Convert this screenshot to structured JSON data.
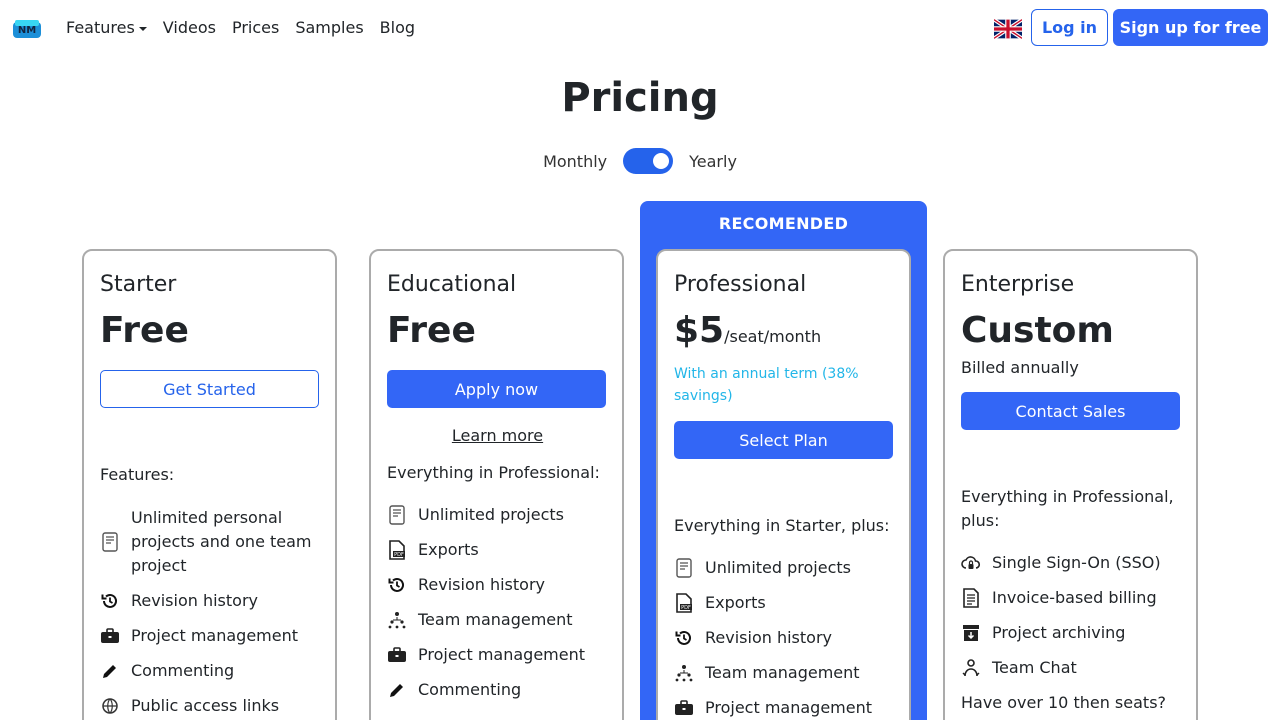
{
  "nav": {
    "links": [
      {
        "label": "Features"
      },
      {
        "label": "Videos"
      },
      {
        "label": "Prices"
      },
      {
        "label": "Samples"
      },
      {
        "label": "Blog"
      }
    ],
    "login_label": "Log in",
    "signup_label": "Sign up for free"
  },
  "header": {
    "title": "Pricing",
    "toggle": {
      "left_label": "Monthly",
      "right_label": "Yearly",
      "selected": "Yearly"
    }
  },
  "recommended_label": "RECOMENDED",
  "plans": [
    {
      "name": "Starter",
      "price": "Free",
      "cta": "Get Started",
      "features_title": "Features:",
      "features": [
        {
          "icon": "document-icon",
          "label": "Unlimited personal projects and one team project"
        },
        {
          "icon": "history-icon",
          "label": "Revision history"
        },
        {
          "icon": "briefcase-icon",
          "label": "Project management"
        },
        {
          "icon": "pencil-icon",
          "label": "Commenting"
        },
        {
          "icon": "globe-icon",
          "label": "Public access links"
        }
      ]
    },
    {
      "name": "Educational",
      "price": "Free",
      "cta": "Apply now",
      "secondary_link": "Learn more",
      "features_title": "Everything in Professional:",
      "features": [
        {
          "icon": "document-icon",
          "label": "Unlimited projects"
        },
        {
          "icon": "pdf-icon",
          "label": "Exports"
        },
        {
          "icon": "history-icon",
          "label": "Revision history"
        },
        {
          "icon": "team-icon",
          "label": "Team management"
        },
        {
          "icon": "briefcase-icon",
          "label": "Project management"
        },
        {
          "icon": "pencil-icon",
          "label": "Commenting"
        }
      ]
    },
    {
      "name": "Professional",
      "price": "$5",
      "price_suffix": "/seat/month",
      "price_note": "With an annual term (38% savings)",
      "cta": "Select Plan",
      "features_title": "Everything in Starter, plus:",
      "features": [
        {
          "icon": "document-icon",
          "label": "Unlimited projects"
        },
        {
          "icon": "pdf-icon",
          "label": "Exports"
        },
        {
          "icon": "history-icon",
          "label": "Revision history"
        },
        {
          "icon": "team-icon",
          "label": "Team management"
        },
        {
          "icon": "briefcase-icon",
          "label": "Project management"
        }
      ]
    },
    {
      "name": "Enterprise",
      "price": "Custom",
      "billed": "Billed annually",
      "cta": "Contact Sales",
      "features_title": "Everything in Professional, plus:",
      "features": [
        {
          "icon": "cloud-lock-icon",
          "label": "Single Sign-On (SSO)"
        },
        {
          "icon": "invoice-icon",
          "label": "Invoice-based billing"
        },
        {
          "icon": "archive-icon",
          "label": "Project archiving"
        },
        {
          "icon": "chat-user-icon",
          "label": "Team Chat"
        }
      ],
      "footer_text": "Have over 10 then seats?"
    }
  ],
  "colors": {
    "accent": "#3366f6",
    "note": "#22b6e8",
    "border": "#ababab"
  }
}
